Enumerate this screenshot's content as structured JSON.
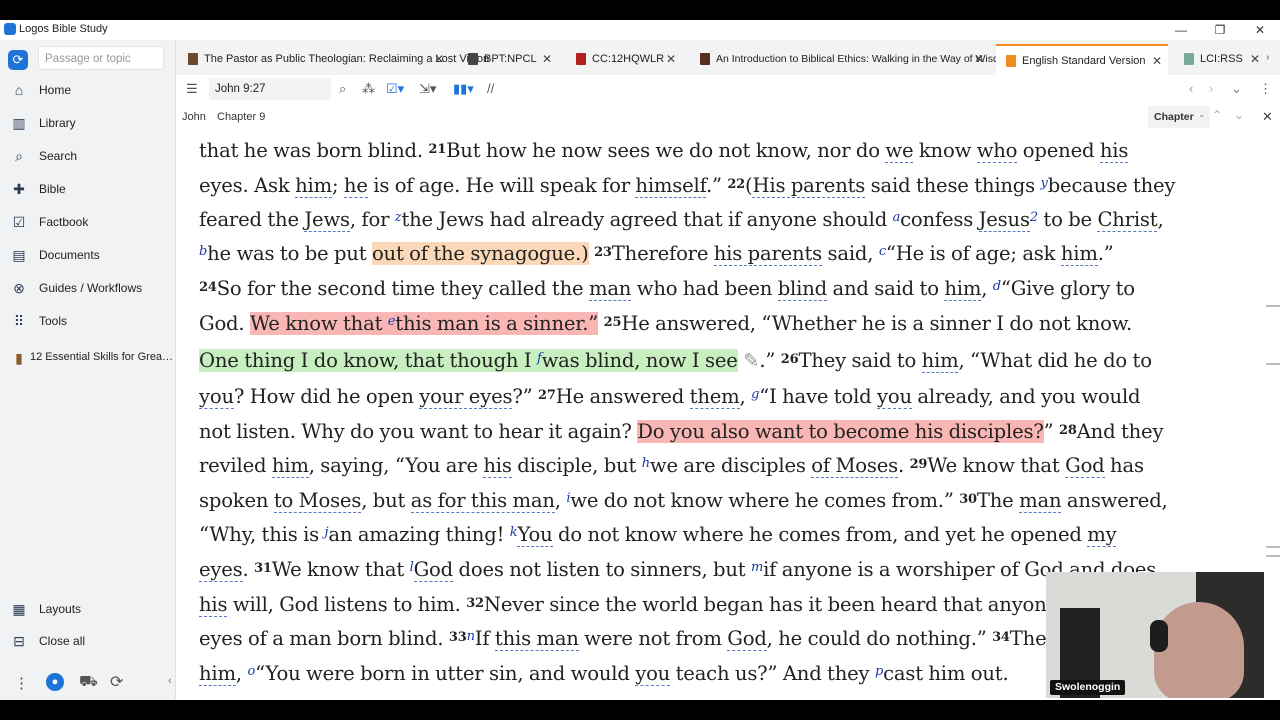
{
  "window": {
    "title": "Logos Bible Study",
    "minimize": "—",
    "restore": "❐",
    "close": "✕"
  },
  "sidebar": {
    "search_placeholder": "Passage or topic",
    "items": [
      {
        "label": "Home",
        "icon": "home-icon",
        "glyph": "⌂"
      },
      {
        "label": "Library",
        "icon": "library-icon",
        "glyph": "▥"
      },
      {
        "label": "Search",
        "icon": "search-icon",
        "glyph": "⌕"
      },
      {
        "label": "Bible",
        "icon": "bible-icon",
        "glyph": "✚"
      },
      {
        "label": "Factbook",
        "icon": "factbook-icon",
        "glyph": "☑"
      },
      {
        "label": "Documents",
        "icon": "documents-icon",
        "glyph": "▤"
      },
      {
        "label": "Guides / Workflows",
        "icon": "guides-icon",
        "glyph": "⊗"
      },
      {
        "label": "Tools",
        "icon": "tools-icon",
        "glyph": "⠿"
      },
      {
        "label": "12 Essential Skills for Grea…",
        "icon": "book-icon",
        "glyph": "▮"
      }
    ],
    "layouts": "Layouts",
    "close_all": "Close all"
  },
  "tabs": [
    {
      "label": "The Pastor as Public Theologian: Reclaiming a Lost Vision",
      "color": "#6b4a2b"
    },
    {
      "label": "BPT:NPCL",
      "color": "#444"
    },
    {
      "label": "CC:12HQWLR",
      "color": "#b21f1f"
    },
    {
      "label": "An Introduction to Biblical Ethics: Walking in the Way of Wisdom",
      "color": "#5a2b1f"
    },
    {
      "label": "English Standard Version",
      "color": "#f28b1e"
    },
    {
      "label": "LCI:RSS",
      "color": "#7a9"
    }
  ],
  "toolbar": {
    "reference": "John 9:27"
  },
  "breadcrumb": {
    "book": "John",
    "chapter": "Chapter 9",
    "scope": "Chapter"
  },
  "webcam": {
    "name": "Swolenoggin"
  }
}
